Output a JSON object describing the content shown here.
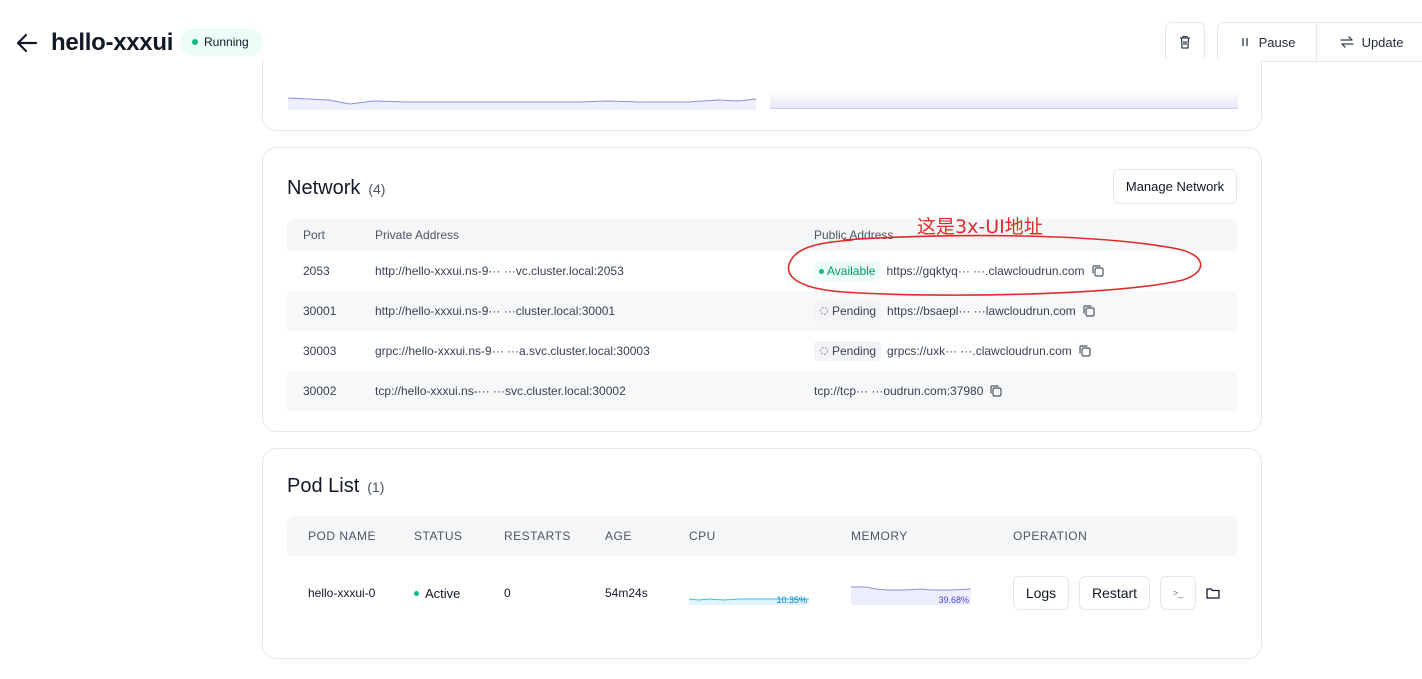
{
  "header": {
    "title": "hello-xxxui",
    "status": "Running",
    "pause_label": "Pause",
    "update_label": "Update"
  },
  "network": {
    "title": "Network",
    "count": "(4)",
    "manage_label": "Manage Network",
    "columns": [
      "Port",
      "Private Address",
      "Public Address"
    ],
    "rows": [
      {
        "port": "2053",
        "private": "http://hello-xxxui.ns-9··· ···vc.cluster.local:2053",
        "status": "Available",
        "public": "https://gqktyq··· ···.clawcloudrun.com"
      },
      {
        "port": "30001",
        "private": "http://hello-xxxui.ns-9··· ···cluster.local:30001",
        "status": "Pending",
        "public": "https://bsaepl··· ···lawcloudrun.com"
      },
      {
        "port": "30003",
        "private": "grpc://hello-xxxui.ns-9··· ···a.svc.cluster.local:30003",
        "status": "Pending",
        "public": "grpcs://uxk··· ···.clawcloudrun.com"
      },
      {
        "port": "30002",
        "private": "tcp://hello-xxxui.ns-··· ···svc.cluster.local:30002",
        "status": "",
        "public": "tcp://tcp··· ···oudrun.com:37980"
      }
    ],
    "annotation": "这是3x-UI地址"
  },
  "pods": {
    "title": "Pod List",
    "count": "(1)",
    "columns": [
      "POD NAME",
      "STATUS",
      "RESTARTS",
      "AGE",
      "CPU",
      "MEMORY",
      "OPERATION"
    ],
    "rows": [
      {
        "name": "hello-xxxui-0",
        "status": "Active",
        "restarts": "0",
        "age": "54m24s",
        "cpu": "10.35%",
        "memory": "39.68%"
      }
    ],
    "logs_label": "Logs",
    "restart_label": "Restart",
    "terminal_glyph": ">_"
  },
  "colors": {
    "running": "#10b981",
    "available": "#059669",
    "annotation": "#e12a2a",
    "cpu_line": "#38bdf8",
    "memory_line": "#8b8fe0"
  },
  "icons": [
    "arrow-left-icon",
    "trash-icon",
    "pause-icon",
    "swap-arrows-icon",
    "copy-icon",
    "spinner-icon",
    "terminal-icon",
    "folder-icon"
  ]
}
